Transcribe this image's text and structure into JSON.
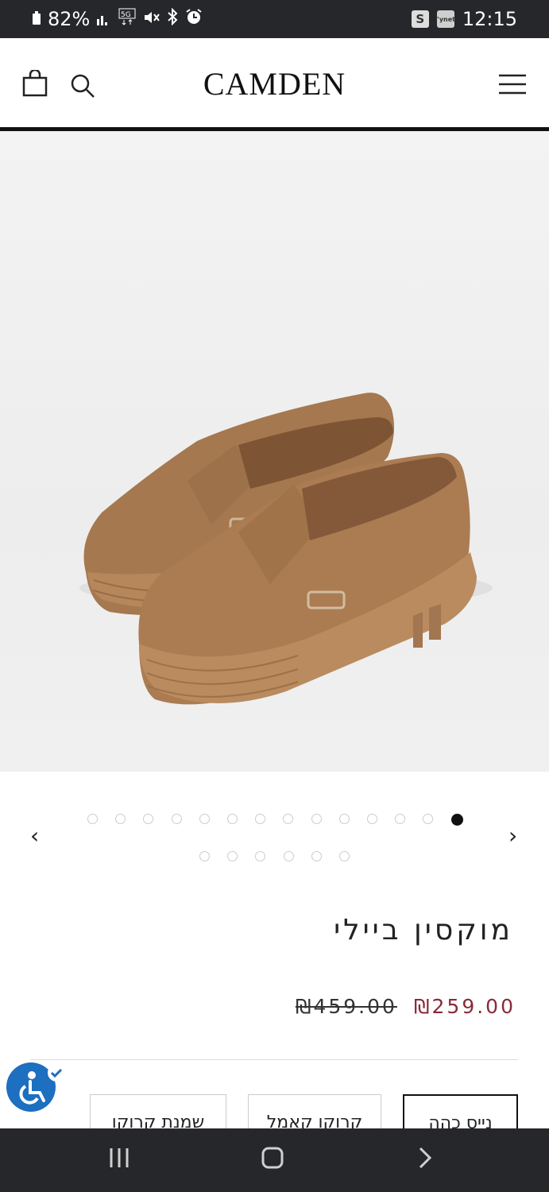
{
  "status_bar": {
    "battery": "82%",
    "time": "12:15",
    "right_badge_1": "S",
    "right_badge_2": "\"ynet"
  },
  "header": {
    "logo": "CAMDEN"
  },
  "carousel": {
    "total_dots": 20,
    "active_index": 13
  },
  "product": {
    "title": "מוקסין ביילי",
    "old_price": "₪459.00",
    "new_price": "₪259.00"
  },
  "colors": [
    {
      "label": "נייס כהה",
      "selected": true
    },
    {
      "label": "קרוקו קאמל",
      "selected": false
    },
    {
      "label": "שמנת קרוקו",
      "selected": false
    }
  ]
}
